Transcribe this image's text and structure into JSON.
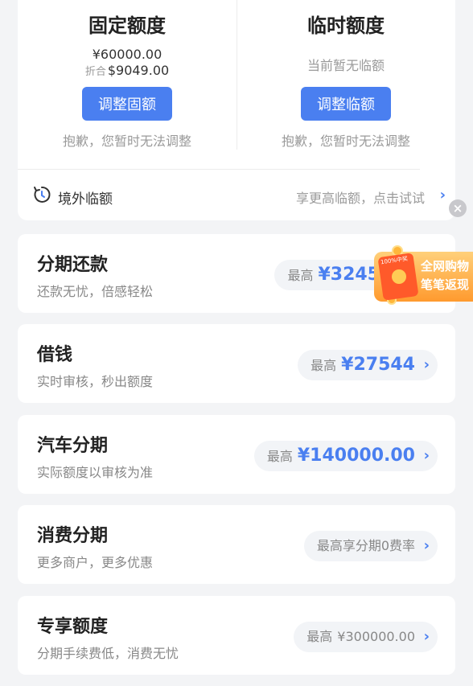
{
  "limits": {
    "fixed": {
      "title": "固定额度",
      "amount": "¥60000.00",
      "converted_prefix": "折合",
      "converted_amount": "$9049.00",
      "button": "调整固额",
      "note": "抱歉，您暂时无法调整"
    },
    "temporary": {
      "title": "临时额度",
      "status": "当前暂无临额",
      "button": "调整临额",
      "note": "抱歉，您暂时无法调整"
    },
    "overseas": {
      "label": "境外临额",
      "tip": "享更高临额，点击试试",
      "chevron": "›"
    }
  },
  "close": "×",
  "promo": {
    "tag": "100%中奖",
    "line1": "全网购物",
    "line2": "笔笔返现"
  },
  "services": [
    {
      "title": "分期还款",
      "subtitle": "还款无忧，倍感轻松",
      "prefix": "最高",
      "value": "¥3245",
      "chevron": "›"
    },
    {
      "title": "借钱",
      "subtitle": "实时审核，秒出额度",
      "prefix": "最高",
      "value": "¥27544",
      "chevron": "›"
    },
    {
      "title": "汽车分期",
      "subtitle": "实际额度以审核为准",
      "prefix": "最高",
      "value": "¥140000.00",
      "chevron": "›"
    },
    {
      "title": "消费分期",
      "subtitle": "更多商户，更多优惠",
      "prefix": "最高享分期0费率",
      "value": "",
      "chevron": "›"
    },
    {
      "title": "专享额度",
      "subtitle": "分期手续费低，消费无忧",
      "prefix": "最高",
      "value": "¥300000.00",
      "chevron": "›"
    }
  ],
  "colors": {
    "accent": "#4a7ff0",
    "background": "#f3f4f6",
    "promo": "#ff9a2e"
  }
}
